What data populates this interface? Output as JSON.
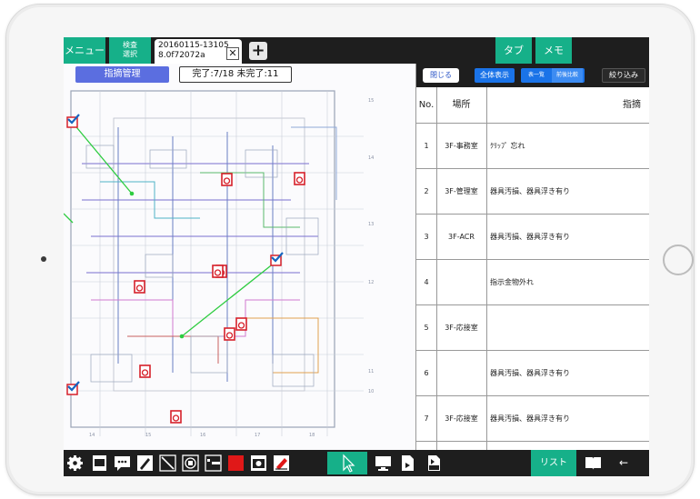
{
  "topbar": {
    "menu_label": "メニュー",
    "inspect_label": "検査\n選択",
    "doc_tab_line1": "20160115-13105",
    "doc_tab_line2": "8.0f72072a",
    "close_label": "✕",
    "add_label": "+",
    "tab_label": "タブ",
    "memo_label": "メモ"
  },
  "drawing": {
    "manage_label": "指摘管理",
    "status_text": "完了:7/18 未完了:11"
  },
  "panel": {
    "close_label": "閉じる",
    "show_all_label": "全体表示",
    "segment_list_label": "表一覧",
    "segment_compare_label": "前後比較",
    "filter_label": "絞り込み",
    "headers": {
      "no": "No.",
      "place": "場所",
      "note": "指摘"
    },
    "rows": [
      {
        "no": "1",
        "place": "3F-事務室",
        "note": "ｸﾘｯﾌﾟ 忘れ"
      },
      {
        "no": "2",
        "place": "3F-管理室",
        "note": "器具汚損、器具浮き有り"
      },
      {
        "no": "3",
        "place": "3F-ACR",
        "note": "器具汚損、器具浮き有り"
      },
      {
        "no": "4",
        "place": "",
        "note": "指示金物外れ"
      },
      {
        "no": "5",
        "place": "3F-応接室",
        "note": ""
      },
      {
        "no": "6",
        "place": "",
        "note": "器具汚損、器具浮き有り"
      },
      {
        "no": "7",
        "place": "3F-応接室",
        "note": "器具汚損、器具浮き有り"
      }
    ]
  },
  "toolbar": {
    "list_label": "リスト",
    "back_label": "←"
  },
  "colors": {
    "accent_green": "#16b089",
    "manage_blue": "#5b6ee0",
    "bar_dark": "#1e1e1e",
    "pin_red": "#d6202a",
    "check_blue": "#1565c0",
    "route_green": "#2ecc40"
  }
}
